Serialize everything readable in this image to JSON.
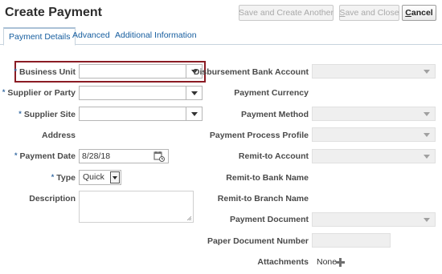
{
  "page": {
    "title": "Create Payment"
  },
  "toolbar": {
    "save_create_another": "Save and Create Another",
    "save_close_prefix": "S",
    "save_close_rest": "ave and Close",
    "cancel_prefix": "C",
    "cancel_rest": "ancel"
  },
  "tabs": [
    {
      "label": "Payment Details",
      "selected": true
    },
    {
      "label": "Advanced",
      "selected": false
    },
    {
      "label": "Additional Information",
      "selected": false
    }
  ],
  "form_left": {
    "business_unit": {
      "label": "Business Unit",
      "required": true,
      "value": ""
    },
    "supplier_or_party": {
      "label": "Supplier or Party",
      "required": true,
      "value": ""
    },
    "supplier_site": {
      "label": "Supplier Site",
      "required": true,
      "value": ""
    },
    "address": {
      "label": "Address"
    },
    "payment_date": {
      "label": "Payment Date",
      "required": true,
      "value": "8/28/18"
    },
    "type": {
      "label": "Type",
      "required": true,
      "value": "Quick"
    },
    "description": {
      "label": "Description",
      "value": ""
    }
  },
  "form_right": {
    "disbursement_bank_account": {
      "label": "Disbursement Bank Account",
      "value": ""
    },
    "payment_currency": {
      "label": "Payment Currency"
    },
    "payment_method": {
      "label": "Payment Method",
      "value": ""
    },
    "payment_process_profile": {
      "label": "Payment Process Profile",
      "value": ""
    },
    "remit_to_account": {
      "label": "Remit-to Account",
      "value": ""
    },
    "remit_to_bank_name": {
      "label": "Remit-to Bank Name"
    },
    "remit_to_branch_name": {
      "label": "Remit-to Branch Name"
    },
    "payment_document": {
      "label": "Payment Document",
      "value": ""
    },
    "paper_document_number": {
      "label": "Paper Document Number",
      "value": ""
    },
    "attachments": {
      "label": "Attachments",
      "value": "None"
    }
  },
  "required_marker": "*",
  "colors": {
    "highlight": "#8b1c24",
    "link": "#145c9e",
    "required": "#3a6ea5"
  },
  "icons": {
    "calendar": "calendar-icon",
    "add": "plus-icon",
    "dropdown": "chevron-down-icon"
  }
}
